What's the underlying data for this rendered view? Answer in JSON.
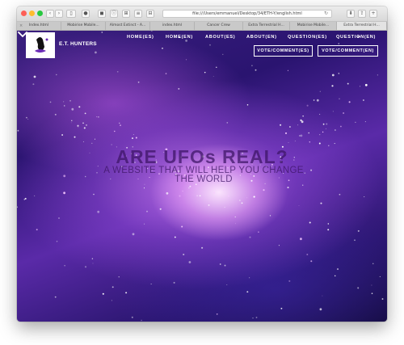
{
  "browser": {
    "address": "file:///Users/emmanuel/Desktop/34/ETH-Y/english.html",
    "tabs": [
      "Index.html",
      "Mobirise Mobile...",
      "Almost Extinct - A...",
      "index.html",
      "Cancer Crew",
      "Extra Terrestrial H...",
      "Mobirise Mobile...",
      "Extra Terrestrial H..."
    ],
    "active_tab": 7
  },
  "site": {
    "brand": "E.T. HUNTERS",
    "nav": [
      "HOME(ES)",
      "HOME(EN)",
      "ABOUT(ES)",
      "ABOUT(EN)",
      "QUESTION(ES)",
      "QUESTION(EN)"
    ],
    "vote_buttons": [
      "VOTE/COMMENT(ES)",
      "VOTE/COMMENT(EN)"
    ],
    "headline": "ARE UFOs REAL?",
    "subheadline": "A WEBSITE THAT WILL HELP YOU CHANGE THE WORLD"
  },
  "colors": {
    "close": "#fd5f57",
    "minimize": "#febc2e",
    "zoom": "#28c840"
  },
  "icons": {
    "scroll_down": "chevron-down-icon"
  }
}
